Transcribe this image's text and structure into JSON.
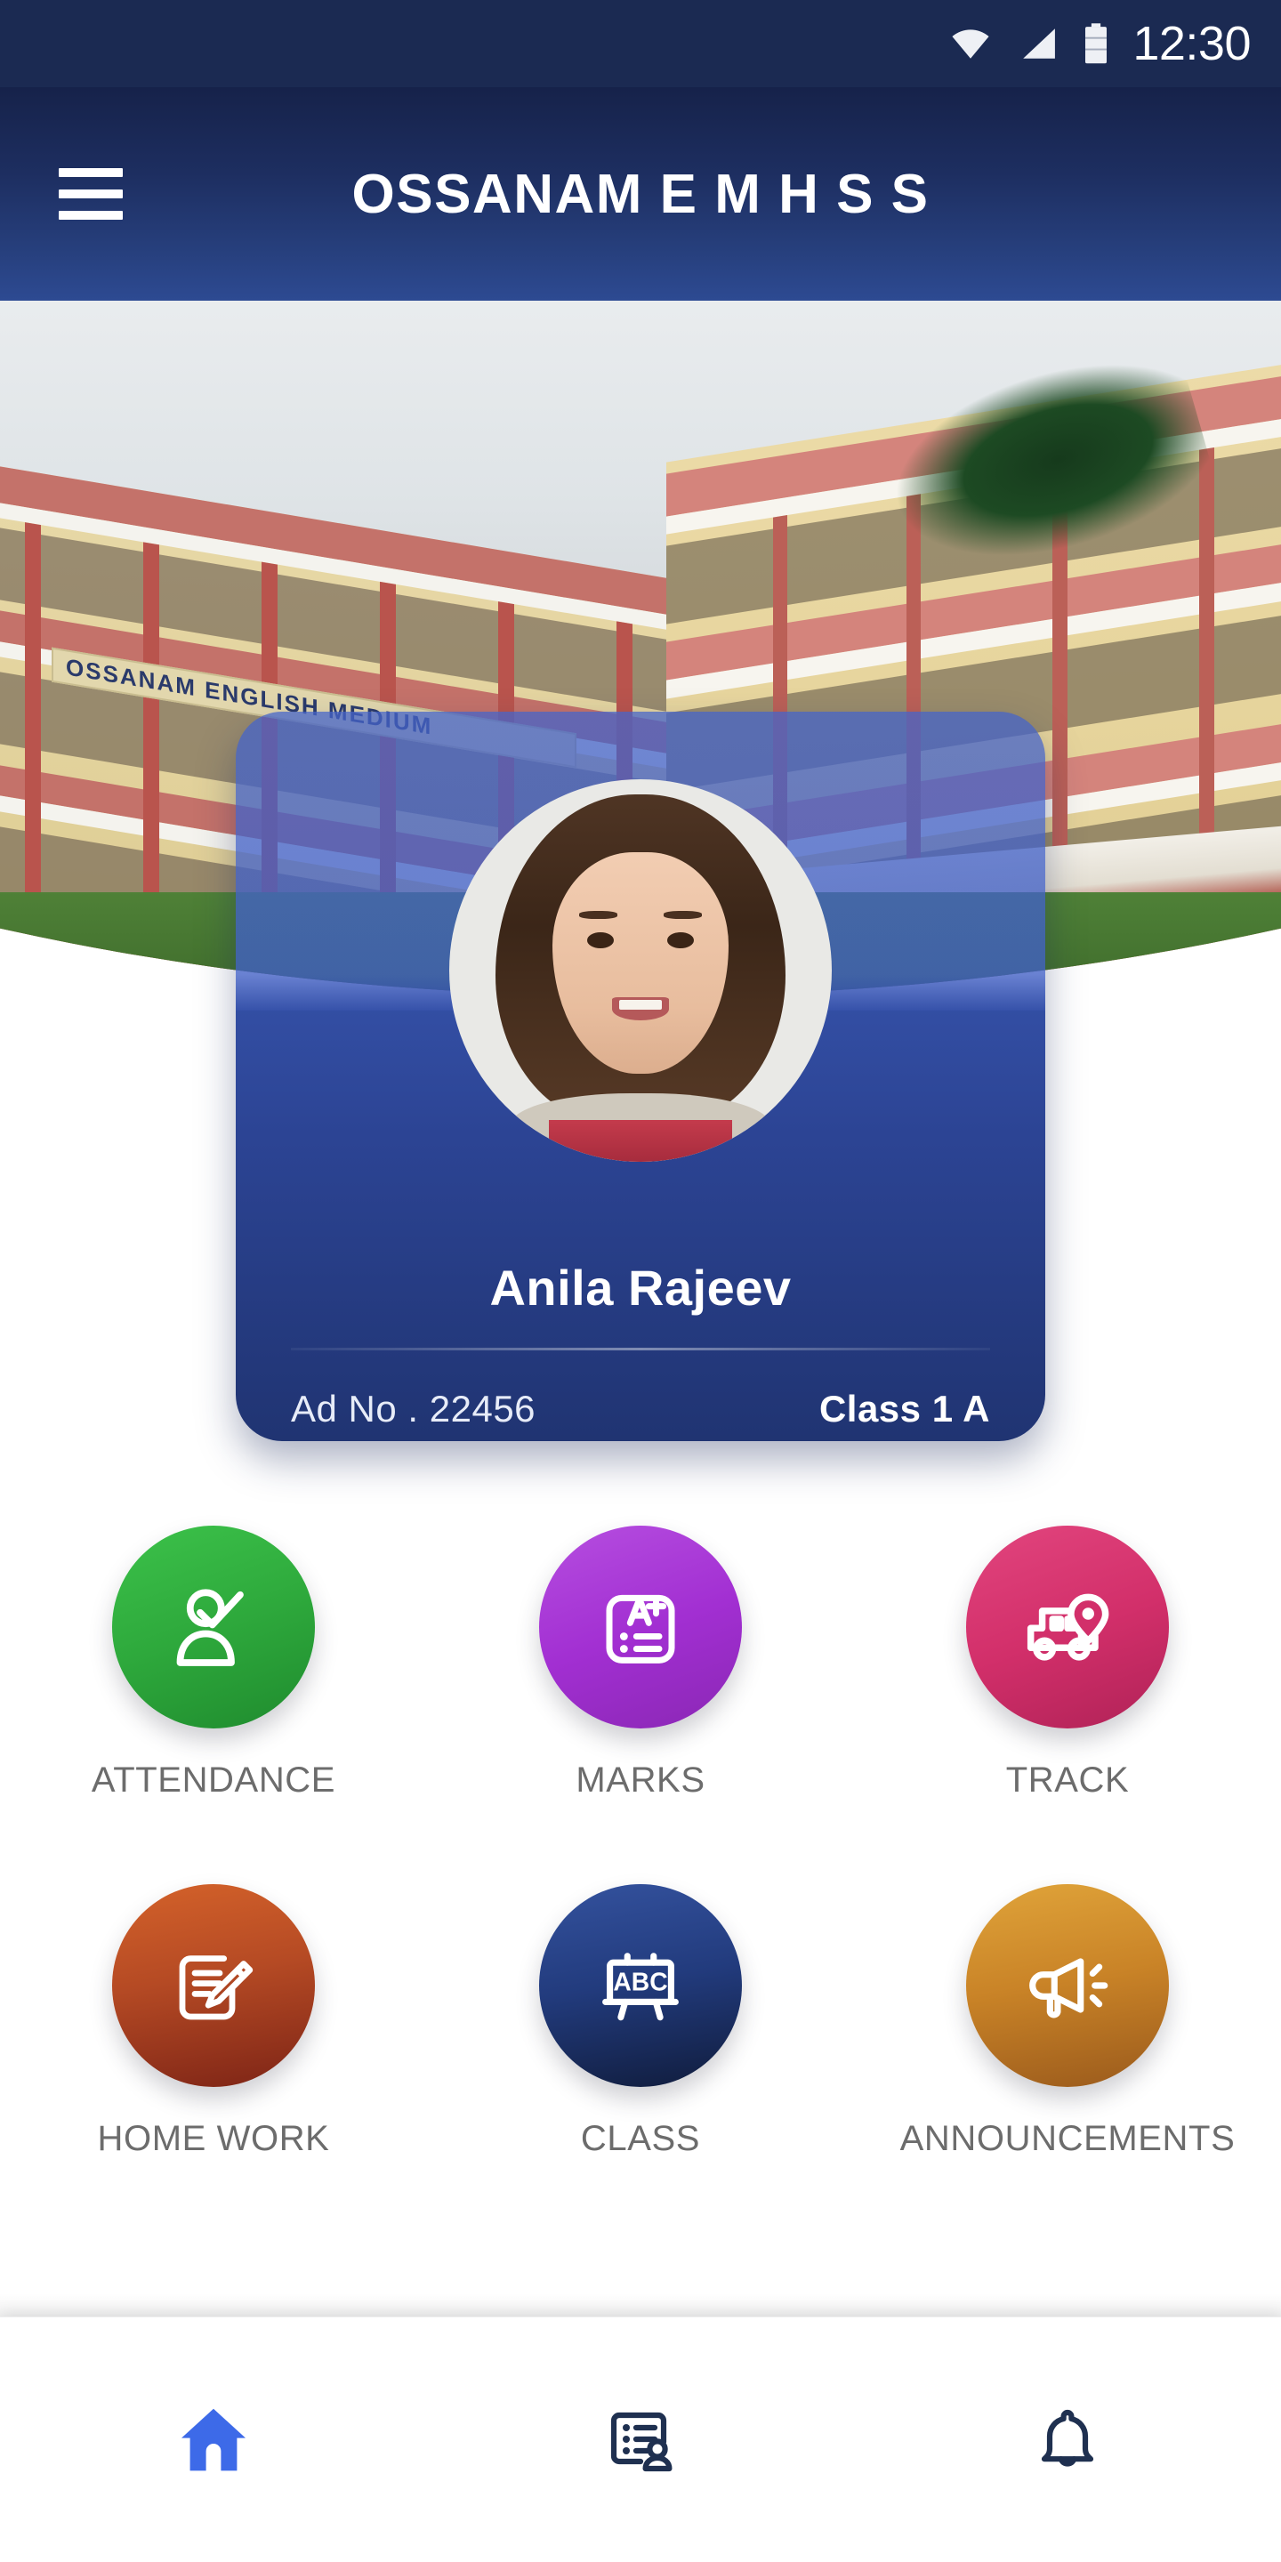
{
  "status_bar": {
    "time": "12:30",
    "icons": [
      "wifi-icon",
      "cellular-signal-icon",
      "battery-icon"
    ]
  },
  "app_bar": {
    "menu_icon": "hamburger-menu-icon",
    "title": "OSSANAM E M H S S"
  },
  "hero": {
    "alt": "school-building-photo",
    "building_sign_text": "OSSANAM ENGLISH MEDIUM"
  },
  "id_card": {
    "avatar": "student-photo",
    "student_name": "Anila Rajeev",
    "admission_label": "Ad No . 22456",
    "class_label": "Class 1 A"
  },
  "shortcuts": {
    "rows": [
      [
        {
          "label": "ATTENDANCE",
          "icon": "person-check-icon",
          "color": "#2ea93c"
        },
        {
          "label": "MARKS",
          "icon": "grade-card-a-plus-icon",
          "color": "#a22fd2"
        },
        {
          "label": "TRACK",
          "icon": "bus-location-pin-icon",
          "color": "#d22f6a"
        }
      ],
      [
        {
          "label": "HOME WORK",
          "icon": "document-pencil-icon",
          "color": "#b54a24"
        },
        {
          "label": "CLASS",
          "icon": "abc-blackboard-icon",
          "color": "#223b7d"
        },
        {
          "label": "ANNOUNCEMENTS",
          "icon": "megaphone-icon",
          "color": "#c98327"
        }
      ]
    ]
  },
  "bottom_nav": {
    "items": [
      {
        "icon": "home-icon",
        "active": true,
        "color": "#3d6ae8"
      },
      {
        "icon": "student-profile-list-icon",
        "active": false,
        "color": "#1f3050"
      },
      {
        "icon": "bell-icon",
        "active": false,
        "color": "#1f3050"
      }
    ]
  },
  "theme": {
    "app_bar_top": "#16224a",
    "app_bar_bottom": "#2d4a92",
    "card_blue": "#2c4494",
    "label_gray": "#6c6c6c",
    "accent_blue": "#3d6ae8"
  }
}
